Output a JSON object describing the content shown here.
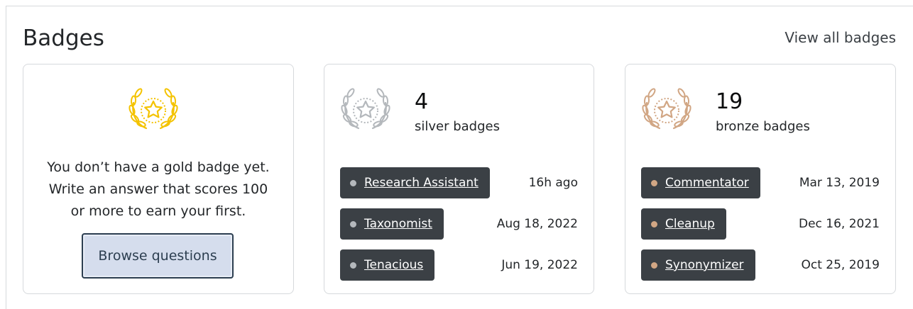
{
  "page": {
    "title": "Badges",
    "view_all_label": "View all badges"
  },
  "colors": {
    "gold": "#f4c300",
    "silver": "#b4b8bc",
    "bronze": "#d1a684",
    "pill_bg": "#3b4045",
    "button_bg": "#d5dded"
  },
  "gold": {
    "icon": "gold-badge-icon",
    "message_line_1": "You don’t have a gold badge yet.",
    "message_line_2": "Write an answer that scores 100",
    "message_line_3": "or more to earn your first.",
    "button_label": "Browse questions"
  },
  "silver": {
    "icon": "silver-badge-icon",
    "count": "4",
    "label": "silver badges",
    "badges": [
      {
        "name": "Research Assistant",
        "date": "16h ago"
      },
      {
        "name": "Taxonomist",
        "date": "Aug 18, 2022"
      },
      {
        "name": "Tenacious",
        "date": "Jun 19, 2022"
      }
    ]
  },
  "bronze": {
    "icon": "bronze-badge-icon",
    "count": "19",
    "label": "bronze badges",
    "badges": [
      {
        "name": "Commentator",
        "date": "Mar 13, 2019"
      },
      {
        "name": "Cleanup",
        "date": "Dec 16, 2021"
      },
      {
        "name": "Synonymizer",
        "date": "Oct 25, 2019"
      }
    ]
  }
}
